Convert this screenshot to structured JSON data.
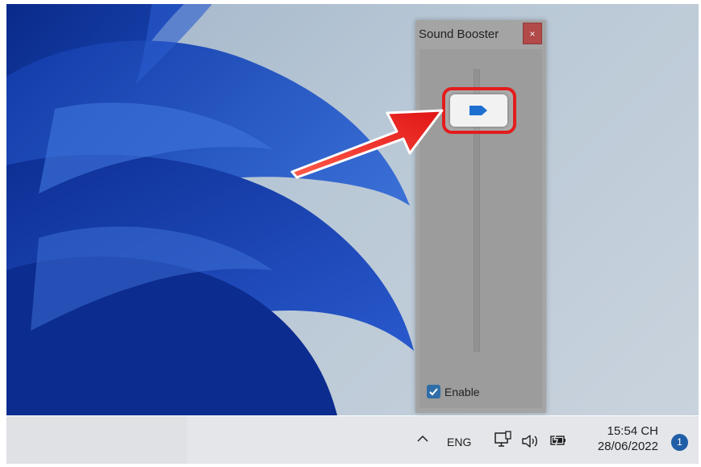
{
  "sound_booster": {
    "title": "Sound Booster",
    "close_label": "×",
    "enable_label": "Enable",
    "enable_checked": true,
    "slider_level": 0.85
  },
  "taskbar": {
    "language": "ENG",
    "time": "15:54 CH",
    "date": "28/06/2022",
    "notification_count": "1"
  },
  "icons": {
    "tray_overflow": "chevron-up-icon",
    "network": "network-icon",
    "volume": "speaker-icon",
    "battery": "battery-icon",
    "slider_thumb": "slider-thumb-icon"
  },
  "colors": {
    "annotation": "#e31d1d",
    "accent": "#1f5ea6",
    "window_bg": "#a4a4a4"
  }
}
